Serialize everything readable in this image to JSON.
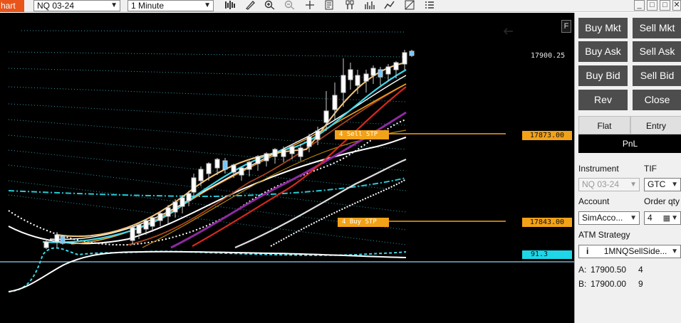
{
  "toolbar": {
    "chart_tab_label": "hart",
    "instrument": "NQ 03-24",
    "interval": "1 Minute",
    "icons": [
      "bar-type-icon",
      "pencil-icon",
      "zoom-in-icon",
      "zoom-out-icon",
      "crosshair-icon",
      "properties-icon",
      "strategies-icon",
      "indicators-icon",
      "chart-style-icon",
      "templates-icon",
      "list-icon"
    ],
    "window_buttons": [
      "minimize",
      "maximize",
      "close"
    ]
  },
  "chart": {
    "f_button": "F",
    "last_price": "17900.25",
    "sell_order_label": "4 Sell STP",
    "sell_order_price": "17873.00",
    "buy_order_label": "4 Buy STP",
    "buy_order_price": "17843.00",
    "indicator_value": "91.3",
    "colors": {
      "background": "#000000",
      "order": "#f2a218",
      "indicator": "#1ed7e8",
      "candle_up": "#ffffff",
      "candle_down": "#6ec8ff"
    }
  },
  "panel": {
    "buttons": {
      "buy_mkt": "Buy Mkt",
      "sell_mkt": "Sell Mkt",
      "buy_ask": "Buy Ask",
      "sell_ask": "Sell Ask",
      "buy_bid": "Buy Bid",
      "sell_bid": "Sell Bid",
      "rev": "Rev",
      "close": "Close"
    },
    "position": {
      "flat": "Flat",
      "entry": "Entry",
      "pnl": "PnL"
    },
    "instrument_label": "Instrument",
    "instrument_value": "NQ 03-24",
    "tif_label": "TIF",
    "tif_value": "GTC",
    "account_label": "Account",
    "account_value": "SimAcco...",
    "order_qty_label": "Order qty",
    "order_qty_value": "4",
    "atm_label": "ATM Strategy",
    "atm_info_icon": "i",
    "atm_value": "1MNQSellSide...",
    "ask_label": "A:",
    "ask_price": "17900.50",
    "ask_size": "4",
    "bid_label": "B:",
    "bid_price": "17900.00",
    "bid_size": "9"
  }
}
